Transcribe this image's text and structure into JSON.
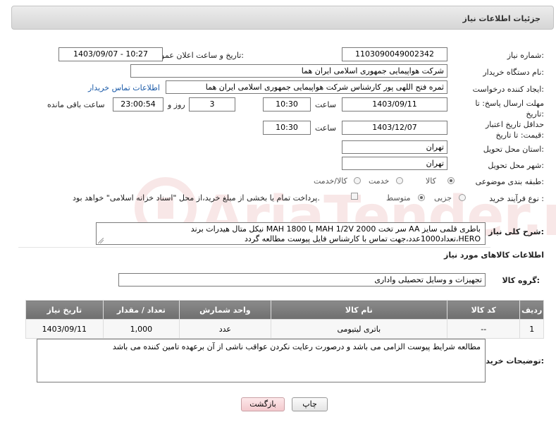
{
  "header": {
    "title": "جزئیات اطلاعات نیاز"
  },
  "need_number": {
    "label": "شماره نیاز:",
    "value": "1103090049002342"
  },
  "announce_datetime": {
    "label": "تاریخ و ساعت اعلان عمومی:",
    "value": "1403/09/07 - 10:27"
  },
  "buyer_org": {
    "label": "نام دستگاه خریدار:",
    "value": "شرکت هواپیمایی جمهوری اسلامی ایران هما"
  },
  "requester": {
    "label": "ایجاد کننده درخواست:",
    "value": "ثمره فتح اللهی پور کارشناس شرکت هواپیمایی جمهوری اسلامی ایران هما",
    "contact_link": "اطلاعات تماس خریدار"
  },
  "reply_deadline": {
    "label": "مهلت ارسال پاسخ: تا تاریخ:",
    "date": "1403/09/11",
    "time_label": "ساعت",
    "time": "10:30",
    "days": "3",
    "days_label": "روز و",
    "remaining": "23:00:54",
    "remaining_label": "ساعت باقی مانده"
  },
  "price_validity": {
    "label": "حداقل تاریخ اعتبار قیمت: تا تاریخ:",
    "date": "1403/12/07",
    "time_label": "ساعت",
    "time": "10:30"
  },
  "delivery_province": {
    "label": "استان محل تحویل:",
    "value": "تهران"
  },
  "delivery_city": {
    "label": "شهر محل تحویل:",
    "value": "تهران"
  },
  "category": {
    "label": "طبقه بندی موضوعی:",
    "options": [
      "کالا",
      "خدمت",
      "کالا/خدمت"
    ],
    "selected": "کالا"
  },
  "purchase_type": {
    "label": "نوع فرآیند خرید :",
    "options": [
      "جزیی",
      "متوسط"
    ],
    "selected": "متوسط",
    "note": "پرداخت تمام یا بخشی از مبلغ خرید،از محل \"اسناد خزانه اسلامی\" خواهد بود."
  },
  "description": {
    "label": "شرح کلی نیاز:",
    "line1": "باطری قلمی سایز AA سر تخت MAH 1/2V 2000  یا  MAH 1800 نیکل متال هیدرات برند",
    "line2": "HERO،تعداد1000عدد،جهت تماس با کارشناس فایل پیوست مطالعه گردد"
  },
  "goods_info": {
    "title": "اطلاعات کالاهای مورد نیاز"
  },
  "goods_group": {
    "label": "گروه کالا:",
    "value": "تجهیزات و وسایل تحصیلی واداری"
  },
  "table": {
    "headers": [
      "ردیف",
      "کد کالا",
      "نام کالا",
      "واحد شمارش",
      "تعداد / مقدار",
      "تاریخ نیاز"
    ],
    "rows": [
      {
        "row": "1",
        "code": "--",
        "name": "باتری لیتیومی",
        "unit": "عدد",
        "qty": "1,000",
        "date": "1403/09/11"
      }
    ]
  },
  "buyer_notes": {
    "label": "توضیحات خریدار:",
    "text": "مطالعه شرایط پیوست الزامی می باشد و درصورت رعایت نکردن عواقب ناشی از آن برعهده تامین کننده می باشد"
  },
  "buttons": {
    "print": "چاپ",
    "back": "بازگشت"
  },
  "watermark": "AriaTender.net",
  "colors": {
    "link": "#1a5aa8",
    "table_header": "#7a7a7a",
    "back_button": "#f3c9cd"
  }
}
